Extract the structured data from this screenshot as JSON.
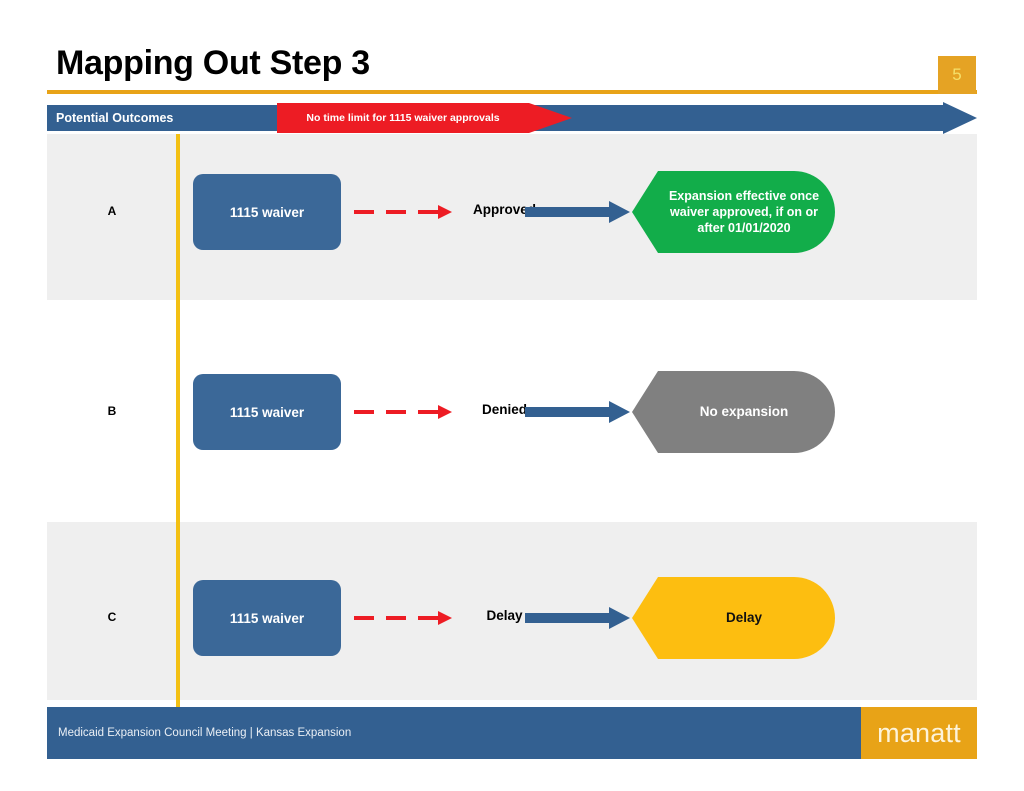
{
  "slide": {
    "title": "Mapping Out Step 3",
    "page_number": "5",
    "accent_gold": "#E8A317",
    "accent_blue": "#336091",
    "band_gray": "#EFEFEF"
  },
  "header": {
    "label": "Potential Outcomes",
    "callout": "No time limit for 1115 waiver approvals",
    "callout_color": "#ED1C24",
    "band_color": "#336091"
  },
  "rows": [
    {
      "letter": "A",
      "source_label": "1115 waiver",
      "outcome_label": "Approved",
      "result_text": "Expansion effective once waiver approved, if on or after 01/01/2020",
      "result_color": "#12AD4A",
      "result_text_color": "light",
      "result_text_size": "small"
    },
    {
      "letter": "B",
      "source_label": "1115 waiver",
      "outcome_label": "Denied",
      "result_text": "No expansion",
      "result_color": "#808080",
      "result_text_color": "light",
      "result_text_size": "big"
    },
    {
      "letter": "C",
      "source_label": "1115 waiver",
      "outcome_label": "Delay",
      "result_text": "Delay",
      "result_color": "#FDBE10",
      "result_text_color": "dark",
      "result_text_size": "big"
    }
  ],
  "footer": {
    "text": "Medicaid Expansion Council Meeting  |  Kansas Expansion",
    "logo": "manatt"
  }
}
